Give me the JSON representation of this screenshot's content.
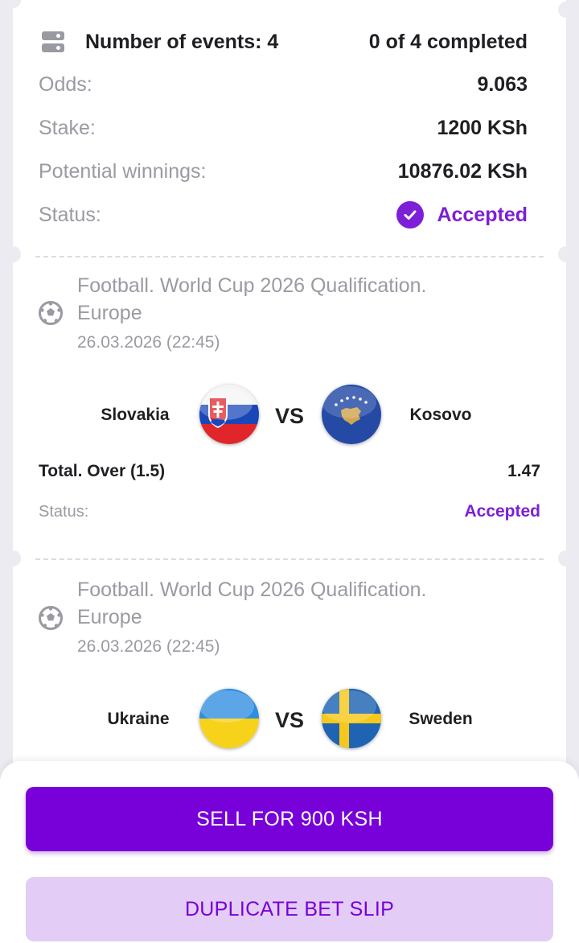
{
  "summary": {
    "events_label": "Number of events: 4",
    "completed": "0 of 4 completed",
    "rows": [
      {
        "label": "Odds:",
        "value": "9.063"
      },
      {
        "label": "Stake:",
        "value": "1200 KSh"
      },
      {
        "label": "Potential winnings:",
        "value": "10876.02 KSh"
      }
    ],
    "status_label": "Status:",
    "status_value": "Accepted"
  },
  "events": [
    {
      "competition": "Football. World Cup 2026 Qualification. Europe",
      "datetime": "26.03.2026 (22:45)",
      "home": "Slovakia",
      "away": "Kosovo",
      "vs": "VS",
      "market": "Total. Over (1.5)",
      "odd": "1.47",
      "status_label": "Status:",
      "status_value": "Accepted"
    },
    {
      "competition": "Football. World Cup 2026 Qualification. Europe",
      "datetime": "26.03.2026 (22:45)",
      "home": "Ukraine",
      "away": "Sweden",
      "vs": "VS"
    }
  ],
  "actions": {
    "sell_label": "SELL FOR 900 KSH",
    "duplicate_label": "DUPLICATE BET SLIP"
  },
  "colors": {
    "accent": "#7800d8",
    "accent_light": "#e3ccf6",
    "muted": "#9a9aa3"
  }
}
